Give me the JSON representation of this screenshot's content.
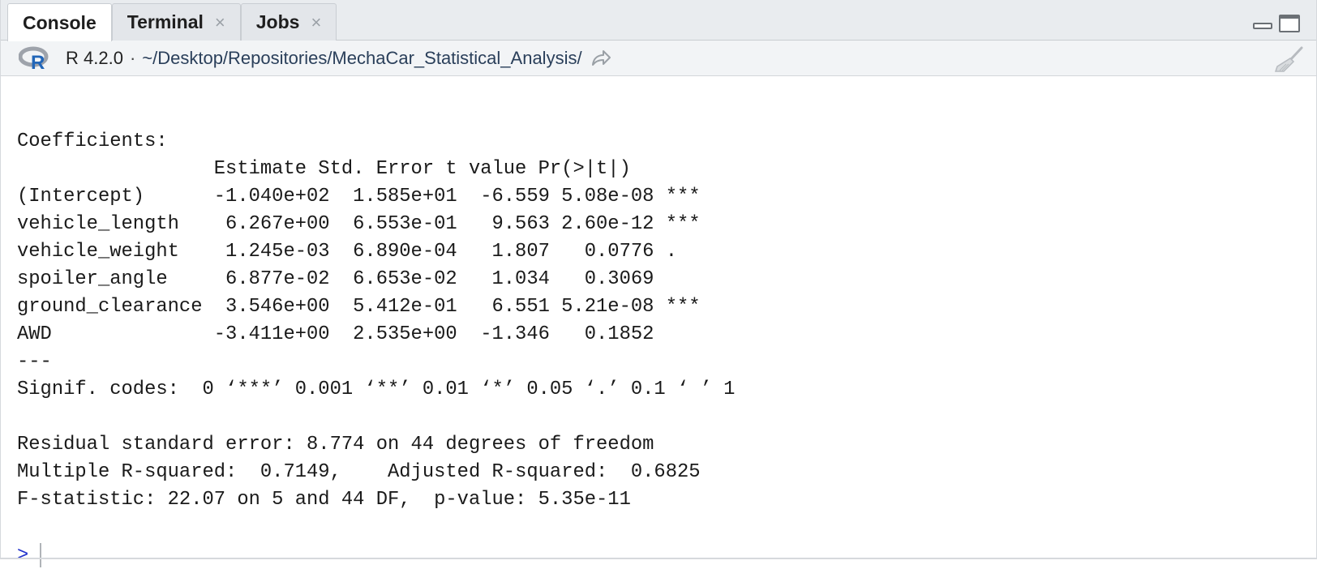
{
  "tabs": [
    {
      "label": "Console",
      "active": true,
      "closable": false
    },
    {
      "label": "Terminal",
      "active": false,
      "closable": true
    },
    {
      "label": "Jobs",
      "active": false,
      "closable": true
    }
  ],
  "tab_close_glyph": "×",
  "pathbar": {
    "r_version": "R 4.2.0",
    "separator": "·",
    "working_dir": "~/Desktop/Repositories/MechaCar_Statistical_Analysis/",
    "icons": [
      "r-logo-icon",
      "go-to-directory-icon",
      "clear-console-broom-icon"
    ]
  },
  "window_controls": [
    "minimize-pane-icon",
    "maximize-pane-icon"
  ],
  "console": {
    "lines": [
      "",
      "Coefficients:",
      "                 Estimate Std. Error t value Pr(>|t|)    ",
      "(Intercept)      -1.040e+02  1.585e+01  -6.559 5.08e-08 ***",
      "vehicle_length    6.267e+00  6.553e-01   9.563 2.60e-12 ***",
      "vehicle_weight    1.245e-03  6.890e-04   1.807   0.0776 .  ",
      "spoiler_angle     6.877e-02  6.653e-02   1.034   0.3069    ",
      "ground_clearance  3.546e+00  5.412e-01   6.551 5.21e-08 ***",
      "AWD              -3.411e+00  2.535e+00  -1.346   0.1852    ",
      "---",
      "Signif. codes:  0 ‘***’ 0.001 ‘**’ 0.01 ‘*’ 0.05 ‘.’ 0.1 ‘ ’ 1",
      "",
      "Residual standard error: 8.774 on 44 degrees of freedom",
      "Multiple R-squared:  0.7149,\tAdjusted R-squared:  0.6825 ",
      "F-statistic: 22.07 on 5 and 44 DF,  p-value: 5.35e-11",
      ""
    ],
    "prompt": ">"
  },
  "colors": {
    "prompt": "#2233cc",
    "tabstrip_bg": "#e9ecef",
    "pathbar_bg": "#f2f4f6",
    "r_logo_ring": "#9ea3ab",
    "r_logo_letter": "#2266b8"
  }
}
